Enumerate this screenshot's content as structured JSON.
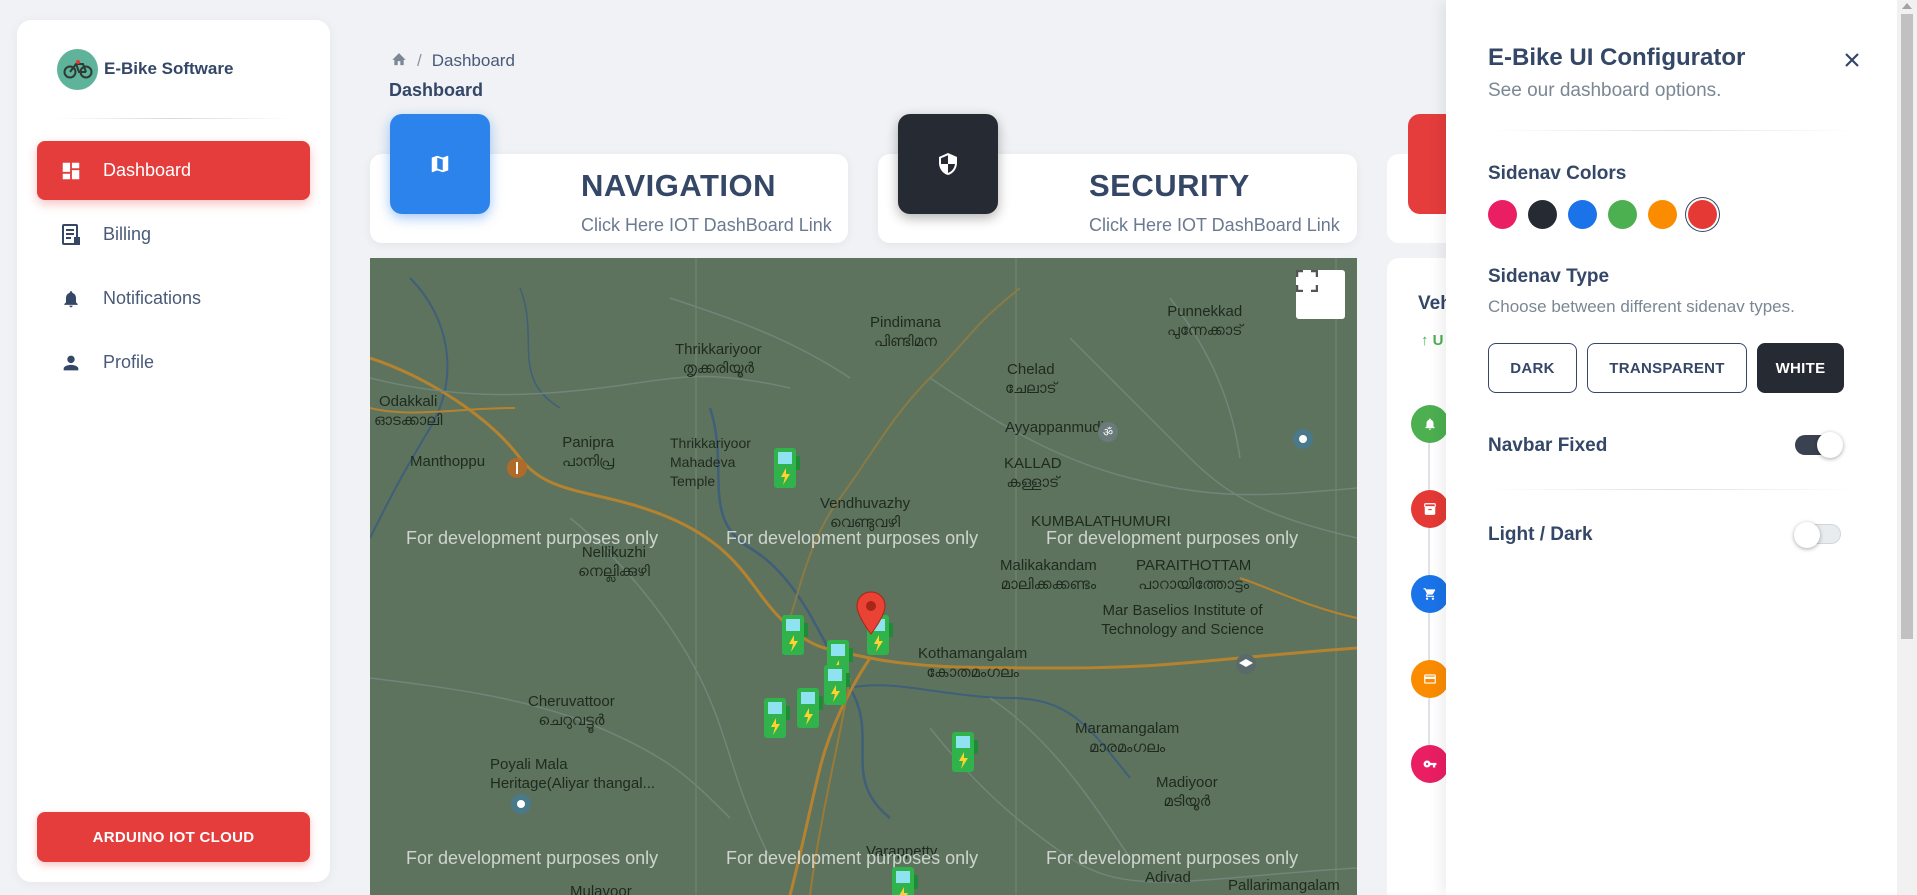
{
  "brand": {
    "name": "E-Bike Software",
    "logo_icon": "bike-icon"
  },
  "sidebar": {
    "items": [
      {
        "label": "Dashboard",
        "icon": "dashboard-icon",
        "active": true
      },
      {
        "label": "Billing",
        "icon": "receipt-icon",
        "active": false
      },
      {
        "label": "Notifications",
        "icon": "bell-icon",
        "active": false
      },
      {
        "label": "Profile",
        "icon": "person-icon",
        "active": false
      }
    ],
    "cloud_button": "ARDUINO IOT CLOUD"
  },
  "breadcrumb": {
    "home_icon": "home-icon",
    "separator": "/",
    "current": "Dashboard"
  },
  "page_title": "Dashboard",
  "cards": [
    {
      "title": "NAVIGATION",
      "link": "Click Here IOT DashBoard Link",
      "icon": "map-icon",
      "color": "#2c83ec"
    },
    {
      "title": "SECURITY",
      "link": "Click Here IOT DashBoard Link",
      "icon": "shield-icon",
      "color": "#262b33"
    }
  ],
  "map": {
    "dev_text": "For development purposes only",
    "labels": [
      {
        "en": "Thrikkariyoor",
        "ml": "തൃക്കരിയൂർ"
      },
      {
        "en": "Pindimana",
        "ml": "പിണ്ടിമന"
      },
      {
        "en": "Chelad",
        "ml": "ചേലാട്"
      },
      {
        "en": "Punnekkad",
        "ml": "പുന്നേക്കാട്"
      },
      {
        "en": "Odakkali",
        "ml": "ഓടക്കാലി"
      },
      {
        "en": "Panipra",
        "ml": "പാനിപ്ര"
      },
      {
        "en": "Ayyappanmudi",
        "ml": ""
      },
      {
        "en": "KALLAD",
        "ml": "കള്ളാട്"
      },
      {
        "en": "Vendhuvazhy",
        "ml": "വെണ്ടുവഴി"
      },
      {
        "en": "KUMBALATHUMURI",
        "ml": ""
      },
      {
        "en": "Nellikuzhi",
        "ml": "നെല്ലിക്കുഴി"
      },
      {
        "en": "Malikakandam",
        "ml": "മാലിക്കക്കണ്ടം"
      },
      {
        "en": "PARAITHOTTAM",
        "ml": "പാറായിത്തോട്ടം"
      },
      {
        "en": "Mar Baselios Institute of Technology and Science",
        "ml": ""
      },
      {
        "en": "Kothamangalam",
        "ml": "കോതമംഗലം"
      },
      {
        "en": "Cheruvattoor",
        "ml": "ചെറുവട്ടൂർ"
      },
      {
        "en": "Maramangalam",
        "ml": "മാരമംഗലം"
      },
      {
        "en": "Poyali Mala Heritage(Aliyar thangal...",
        "ml": ""
      },
      {
        "en": "Madiyoor",
        "ml": "മടിയൂർ"
      },
      {
        "en": "Adivad",
        "ml": ""
      },
      {
        "en": "Pallarimangalam",
        "ml": ""
      },
      {
        "en": "Varappetty",
        "ml": ""
      },
      {
        "en": "Mulavoor",
        "ml": ""
      },
      {
        "en": "Manthoppu",
        "ml": ""
      },
      {
        "en": "Thrikkariyoor Mahadeva Temple",
        "ml": ""
      }
    ],
    "fullscreen_icon": "fullscreen-icon",
    "marker_icon": "map-pin-icon",
    "charger_icon": "ev-charger-icon"
  },
  "timeline": {
    "title": "Veh",
    "subtitle": "↑ U",
    "dots": [
      {
        "icon": "bell-icon",
        "color": "#4caf50"
      },
      {
        "icon": "archive-icon",
        "color": "#e53935"
      },
      {
        "icon": "cart-icon",
        "color": "#1a73e8"
      },
      {
        "icon": "card-icon",
        "color": "#fb8c00"
      },
      {
        "icon": "key-icon",
        "color": "#e91e63"
      }
    ]
  },
  "configurator": {
    "title": "E-Bike UI Configurator",
    "subtitle": "See our dashboard options.",
    "close_icon": "close-icon",
    "sidenav_colors_label": "Sidenav Colors",
    "colors": [
      "#e91e63",
      "#262b33",
      "#1a73e8",
      "#4caf50",
      "#fb8c00",
      "#e53935"
    ],
    "selected_color": "#e53935",
    "sidenav_type_label": "Sidenav Type",
    "sidenav_type_desc": "Choose between different sidenav types.",
    "type_buttons": [
      "DARK",
      "TRANSPARENT",
      "WHITE"
    ],
    "selected_type": "WHITE",
    "navbar_fixed_label": "Navbar Fixed",
    "navbar_fixed": true,
    "light_dark_label": "Light / Dark",
    "dark_mode": false
  }
}
